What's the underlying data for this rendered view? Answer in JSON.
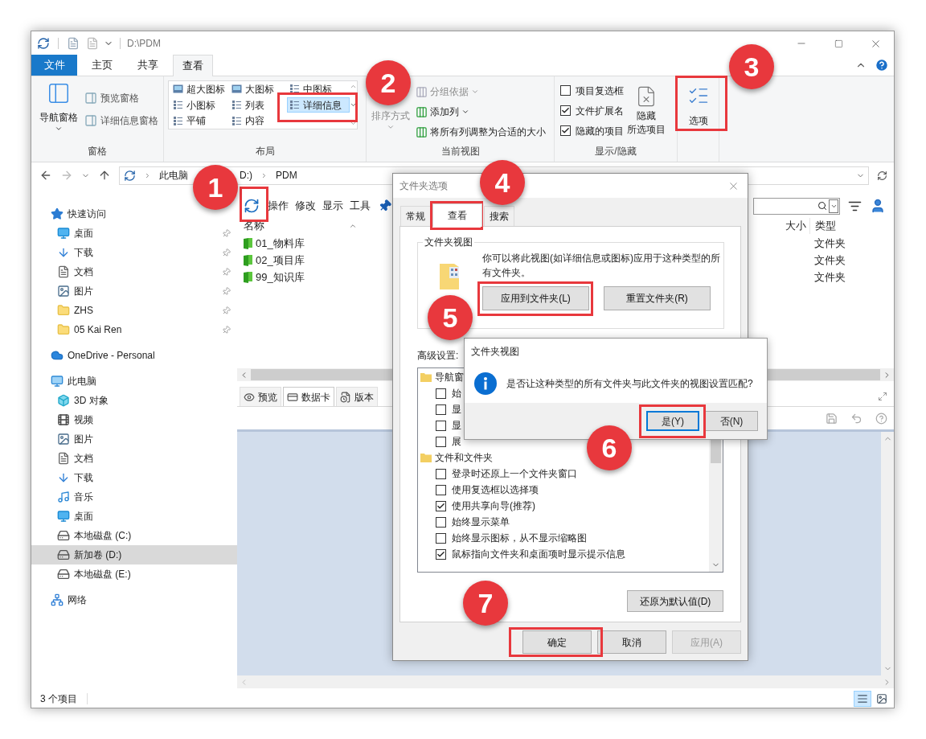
{
  "window": {
    "path": "D:\\PDM"
  },
  "ribbon_tabs": [
    {
      "label": "文件",
      "kind": "file",
      "selected": false
    },
    {
      "label": "主页",
      "kind": "tab",
      "selected": false
    },
    {
      "label": "共享",
      "kind": "tab",
      "selected": false
    },
    {
      "label": "查看",
      "kind": "tab",
      "selected": true
    }
  ],
  "ribbon": {
    "panes": {
      "label": "窗格",
      "nav_pane": "导航窗格",
      "items": [
        "预览窗格",
        "详细信息窗格"
      ]
    },
    "layout": {
      "label": "布局",
      "items": [
        {
          "label": "超大图标",
          "selected": false
        },
        {
          "label": "大图标",
          "selected": false
        },
        {
          "label": "中图标",
          "selected": false
        },
        {
          "label": "小图标",
          "selected": false
        },
        {
          "label": "列表",
          "selected": false
        },
        {
          "label": "详细信息",
          "selected": true
        },
        {
          "label": "平铺",
          "selected": false
        },
        {
          "label": "内容",
          "selected": false
        }
      ]
    },
    "current_view": {
      "label": "当前视图",
      "sort": {
        "label": "排序方式",
        "disabled": true
      },
      "items": [
        {
          "label": "分组依据",
          "kind": "dropdown",
          "disabled": true
        },
        {
          "label": "添加列",
          "kind": "dropdown",
          "disabled": false
        },
        {
          "label": "将所有列调整为合适的大小",
          "kind": "plain",
          "disabled": false
        }
      ]
    },
    "show_hide": {
      "label": "显示/隐藏",
      "checks": [
        {
          "label": "项目复选框",
          "checked": false
        },
        {
          "label": "文件扩展名",
          "checked": true
        },
        {
          "label": "隐藏的项目",
          "checked": true
        }
      ],
      "hide_selected": [
        "隐藏",
        "所选项目"
      ]
    },
    "options": {
      "label": "选项"
    }
  },
  "address": {
    "crumbs": [
      "此电脑",
      "D:)",
      "PDM"
    ]
  },
  "nav": [
    {
      "label": "快速访问",
      "kind": "star",
      "selected": false,
      "children": [
        {
          "label": "桌面",
          "kind": "desktop",
          "selected": false,
          "pinned": true
        },
        {
          "label": "下载",
          "kind": "download",
          "selected": false,
          "pinned": true
        },
        {
          "label": "文档",
          "kind": "document",
          "selected": false,
          "pinned": true
        },
        {
          "label": "图片",
          "kind": "picture",
          "selected": false,
          "pinned": true
        },
        {
          "label": "ZHS",
          "kind": "folder",
          "selected": false,
          "pinned": true
        },
        {
          "label": "05 Kai Ren",
          "kind": "folder",
          "selected": false,
          "pinned": true
        }
      ]
    },
    {
      "label": "OneDrive - Personal",
      "kind": "cloud",
      "selected": false
    },
    {
      "label": "此电脑",
      "kind": "computer",
      "selected": false,
      "children": [
        {
          "label": "3D 对象",
          "kind": "cube",
          "selected": false
        },
        {
          "label": "视频",
          "kind": "video",
          "selected": false
        },
        {
          "label": "图片",
          "kind": "picture",
          "selected": false
        },
        {
          "label": "文档",
          "kind": "document",
          "selected": false
        },
        {
          "label": "下载",
          "kind": "download",
          "selected": false
        },
        {
          "label": "音乐",
          "kind": "music",
          "selected": false
        },
        {
          "label": "桌面",
          "kind": "desktop",
          "selected": false
        },
        {
          "label": "本地磁盘 (C:)",
          "kind": "drive",
          "selected": false
        },
        {
          "label": "新加卷 (D:)",
          "kind": "drive",
          "selected": true
        },
        {
          "label": "本地磁盘 (E:)",
          "kind": "drive",
          "selected": false
        }
      ]
    },
    {
      "label": "网络",
      "kind": "network",
      "selected": false
    }
  ],
  "pdm_toolbar": [
    "操作",
    "修改",
    "显示",
    "工具"
  ],
  "columns": [
    "名称",
    "大小",
    "类型"
  ],
  "files": [
    {
      "name": "01_物料库",
      "type": "文件夹"
    },
    {
      "name": "02_项目库",
      "type": "文件夹"
    },
    {
      "name": "99_知识库",
      "type": "文件夹"
    }
  ],
  "bottom_tabs": [
    {
      "label": "预览",
      "selected": false
    },
    {
      "label": "数据卡",
      "selected": true
    },
    {
      "label": "版本",
      "selected": false
    }
  ],
  "status_bar": {
    "count": "3 个项目",
    "views": [
      {
        "kind": "details",
        "selected": true
      },
      {
        "kind": "thumbnails",
        "selected": false
      }
    ]
  },
  "dialog": {
    "title": "文件夹选项",
    "tabs": [
      {
        "label": "常规",
        "selected": false
      },
      {
        "label": "查看",
        "selected": true
      },
      {
        "label": "搜索",
        "selected": false
      }
    ],
    "folder_views": {
      "legend": "文件夹视图",
      "text": "你可以将此视图(如详细信息或图标)应用于这种类型的所有文件夹。",
      "buttons": [
        "应用到文件夹(L)",
        "重置文件夹(R)"
      ]
    },
    "advanced_label": "高级设置:",
    "settings": [
      {
        "kind": "group",
        "label": "导航窗"
      },
      {
        "kind": "check",
        "label": "始",
        "checked": false
      },
      {
        "kind": "check",
        "label": "显",
        "checked": false
      },
      {
        "kind": "check",
        "label": "显",
        "checked": false
      },
      {
        "kind": "check",
        "label": "展",
        "checked": false
      },
      {
        "kind": "group",
        "label": "文件和文件夹"
      },
      {
        "kind": "check",
        "label": "登录时还原上一个文件夹窗口",
        "checked": false
      },
      {
        "kind": "check",
        "label": "使用复选框以选择项",
        "checked": false
      },
      {
        "kind": "check",
        "label": "使用共享向导(推荐)",
        "checked": true
      },
      {
        "kind": "check",
        "label": "始终显示菜单",
        "checked": false
      },
      {
        "kind": "check",
        "label": "始终显示图标，从不显示缩略图",
        "checked": false
      },
      {
        "kind": "check",
        "label": "鼠标指向文件夹和桌面项时显示提示信息",
        "checked": true
      }
    ],
    "restore_button": "还原为默认值(D)",
    "buttons": [
      {
        "label": "确定",
        "disabled": false
      },
      {
        "label": "取消",
        "disabled": false
      },
      {
        "label": "应用(A)",
        "disabled": true
      }
    ]
  },
  "message_box": {
    "title": "文件夹视图",
    "text": "是否让这种类型的所有文件夹与此文件夹的视图设置匹配?",
    "buttons": [
      {
        "label": "是(Y)",
        "selected": true
      },
      {
        "label": "否(N)",
        "selected": false
      }
    ]
  },
  "annotations": [
    "1",
    "2",
    "3",
    "4",
    "5",
    "6",
    "7"
  ]
}
